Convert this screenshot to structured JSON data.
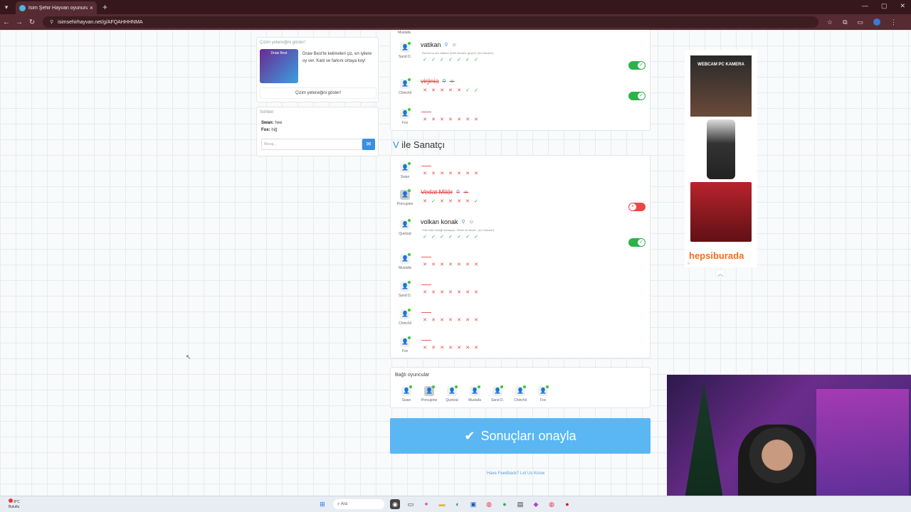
{
  "browser": {
    "tab_title": "İsim Şehir Hayvan oyununa katı",
    "url": "isimsehirhayvan.net/g/AFQAHHHNMA"
  },
  "draw_card": {
    "header": "Çizim yeteneğini göster!",
    "image_text": "Draw Best",
    "text": "Draw Best'te kelimeleri çiz, en iyilere oy ver. Katıl ve farkını ortaya koy!",
    "button": "Çizim yeteneğini göster!"
  },
  "chat": {
    "header": "Sohbet",
    "messages": [
      {
        "user": "Swan:",
        "text": "hee"
      },
      {
        "user": "Fox:",
        "text": "hiğ"
      }
    ],
    "placeholder": "Mesaj..."
  },
  "prev_section": {
    "top_partial_name": "Mustafa",
    "rows": [
      {
        "player": "Sand D.",
        "answer": "vatikan",
        "note": "Roma'nın adı Vatikan Şehir Devleti, geçerli. (AI Checker)",
        "marks": [
          "ok",
          "ok",
          "ok",
          "ok",
          "ok",
          "ok",
          "ok"
        ],
        "toggle": "on"
      },
      {
        "player": "Chinchil",
        "answer": "virjinia",
        "note": "",
        "marks": [
          "x",
          "x",
          "x",
          "x",
          "x",
          "ok",
          "ok"
        ],
        "toggle": "on"
      },
      {
        "player": "Fox",
        "answer": "",
        "note": "",
        "marks": [
          "x",
          "x",
          "x",
          "x",
          "x",
          "x",
          "x"
        ],
        "toggle": ""
      }
    ]
  },
  "section": {
    "letter": "V",
    "title": "ile Sanatçı",
    "rows": [
      {
        "player": "Swan",
        "answer": "",
        "note": "",
        "marks": [
          "x",
          "x",
          "x",
          "x",
          "x",
          "x",
          "x"
        ],
        "toggle": ""
      },
      {
        "player": "Porcupine",
        "answer": "Vedat Milör",
        "note": "",
        "marks": [
          "x",
          "ok",
          "x",
          "x",
          "x",
          "x",
          "ok"
        ],
        "toggle": "off"
      },
      {
        "player": "Quetzal",
        "answer": "volkan konak",
        "note": "Türk halk müziği sanatçısı, 'Mora' ile tanınır. (AI Checker)",
        "marks": [
          "ok",
          "ok",
          "ok",
          "ok",
          "ok",
          "ok",
          "ok"
        ],
        "toggle": "on"
      },
      {
        "player": "Mustafa",
        "answer": "",
        "note": "",
        "marks": [
          "x",
          "x",
          "x",
          "x",
          "x",
          "x",
          "x"
        ],
        "toggle": ""
      },
      {
        "player": "Sand D.",
        "answer": "",
        "note": "",
        "marks": [
          "x",
          "x",
          "x",
          "x",
          "x",
          "x",
          "x"
        ],
        "toggle": ""
      },
      {
        "player": "Chinchil",
        "answer": "",
        "note": "",
        "marks": [
          "x",
          "x",
          "x",
          "x",
          "x",
          "x",
          "x"
        ],
        "toggle": ""
      },
      {
        "player": "Fox",
        "answer": "",
        "note": "",
        "marks": [
          "x",
          "x",
          "x",
          "x",
          "x",
          "x",
          "x"
        ],
        "toggle": ""
      }
    ]
  },
  "connected": {
    "header": "Bağlı oyuncular",
    "players": [
      "Swan",
      "Porcupine",
      "Quetzal",
      "Mustafa",
      "Sand D.",
      "Chinchil",
      "Fox"
    ]
  },
  "confirm_button": "Sonuçları onayla",
  "feedback": "Have Feedback? Let Us Know",
  "ad": {
    "headline": "WEBCAM PC KAMERA",
    "brand": "hepsiburada"
  },
  "taskbar": {
    "temp": "8°C",
    "weather": "Bulutlu",
    "search": "Ara"
  }
}
